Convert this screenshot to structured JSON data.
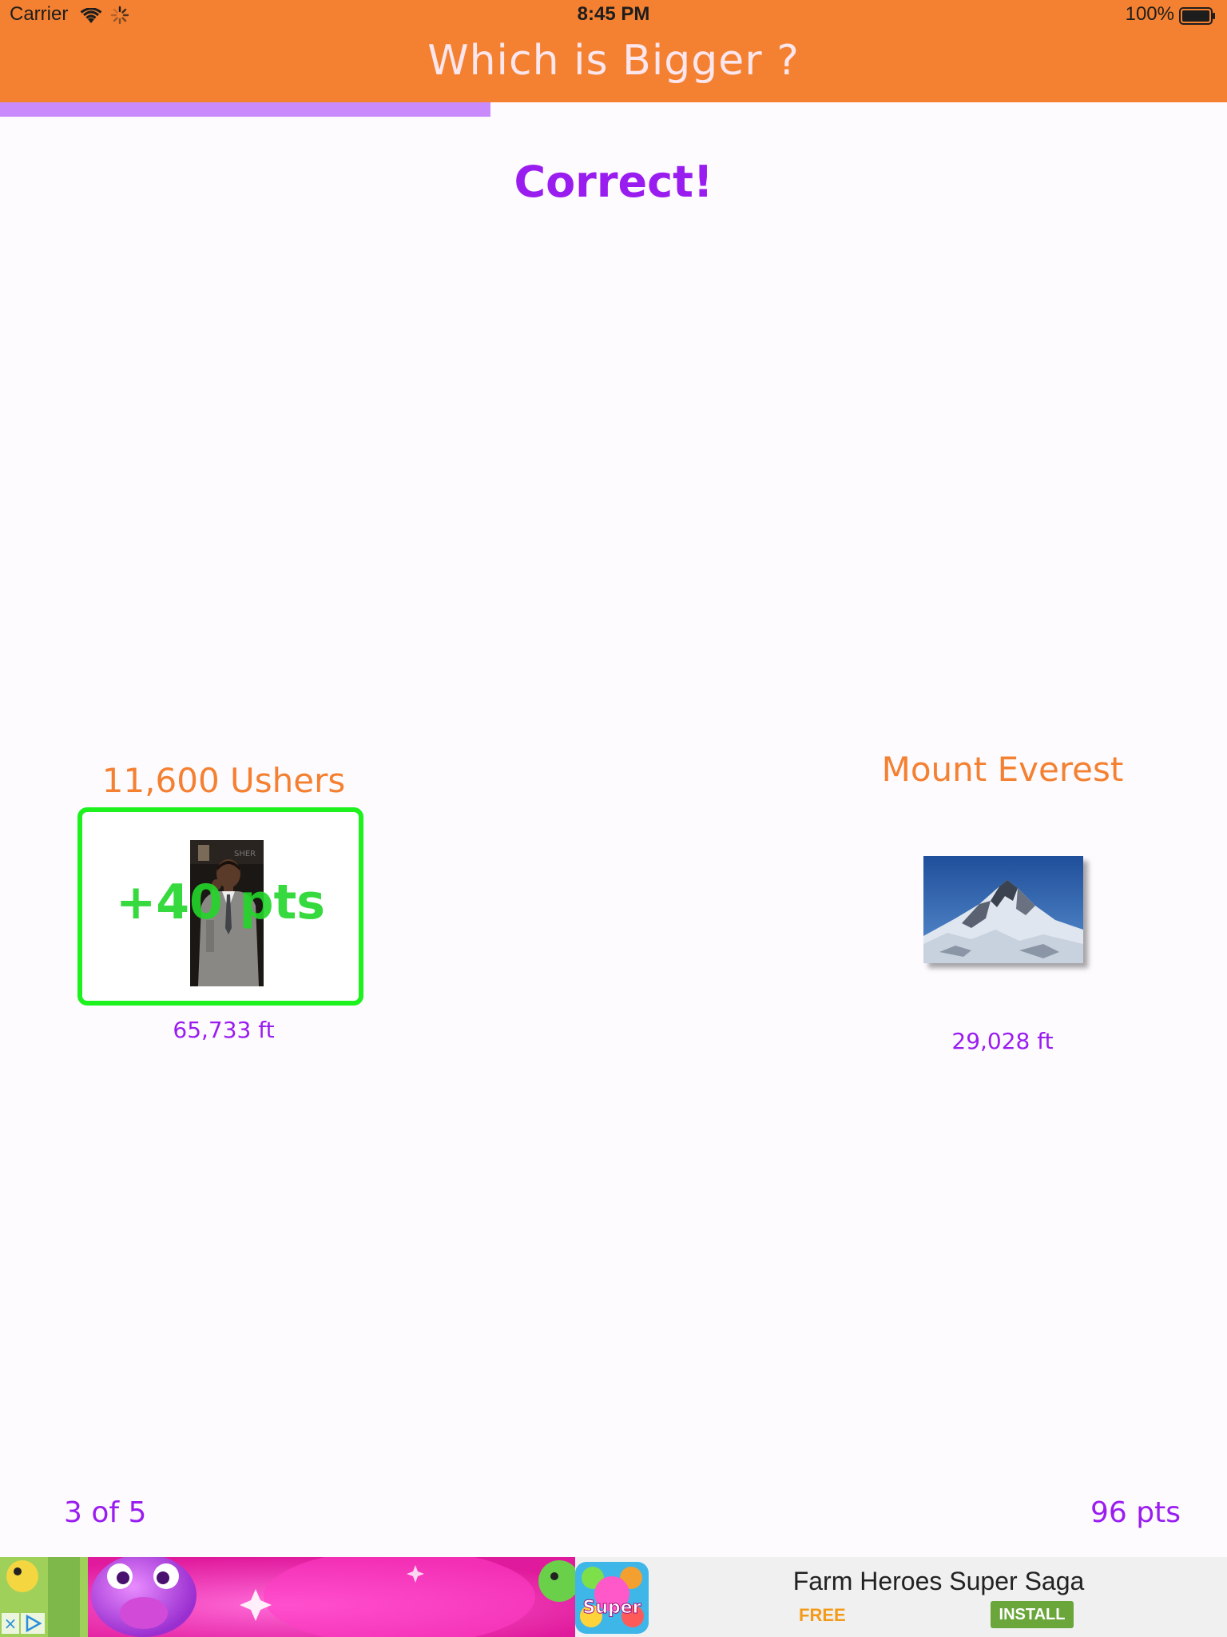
{
  "status_bar": {
    "carrier": "Carrier",
    "time": "8:45 PM",
    "battery": "100%",
    "wifi_icon": "wifi-icon",
    "activity_icon": "activity-spinner-icon",
    "battery_icon": "battery-icon"
  },
  "header": {
    "title": "Which is Bigger ?",
    "background_color": "#f48131"
  },
  "progress": {
    "fraction": 0.4
  },
  "result": {
    "message": "Correct!"
  },
  "items": {
    "left": {
      "title": "11,600 Ushers",
      "value": "65,733 ft",
      "points_awarded": "+40 pts",
      "selected": true
    },
    "right": {
      "title": "Mount Everest",
      "value": "29,028 ft",
      "selected": false
    }
  },
  "footer": {
    "round": "3 of 5",
    "score": "96 pts"
  },
  "ad": {
    "title": "Farm Heroes Super Saga",
    "price": "FREE",
    "install_label": "INSTALL",
    "close_label": "×",
    "icon_text": "Super"
  },
  "colors": {
    "accent_orange": "#f48131",
    "accent_purple": "#9a1df0",
    "progress_purple": "#c98bfc",
    "correct_green": "#1ef21e",
    "install_green": "#6aa63a"
  }
}
